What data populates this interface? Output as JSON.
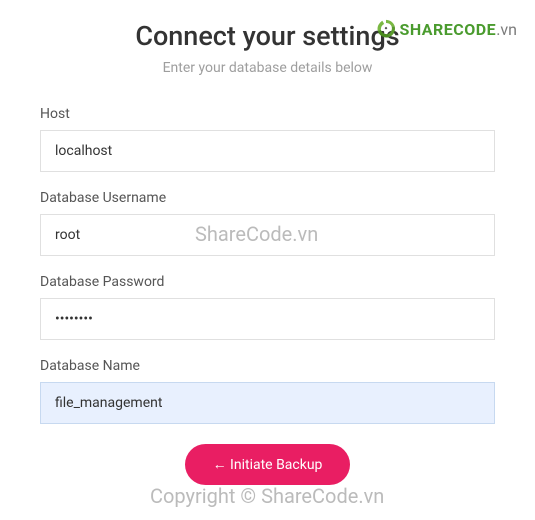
{
  "header": {
    "title": "Connect your settings",
    "subtitle": "Enter your database details below"
  },
  "logo": {
    "text1": "SHARE",
    "text2": "CODE",
    "suffix": ".vn"
  },
  "form": {
    "host": {
      "label": "Host",
      "value": "localhost"
    },
    "username": {
      "label": "Database Username",
      "value": "root"
    },
    "password": {
      "label": "Database Password",
      "value": "••••••••"
    },
    "dbname": {
      "label": "Database Name",
      "value": "file_management"
    },
    "submit_label": "← Initiate Backup"
  },
  "watermarks": {
    "wm1": "ShareCode.vn",
    "wm2": "Copyright © ShareCode.vn"
  }
}
